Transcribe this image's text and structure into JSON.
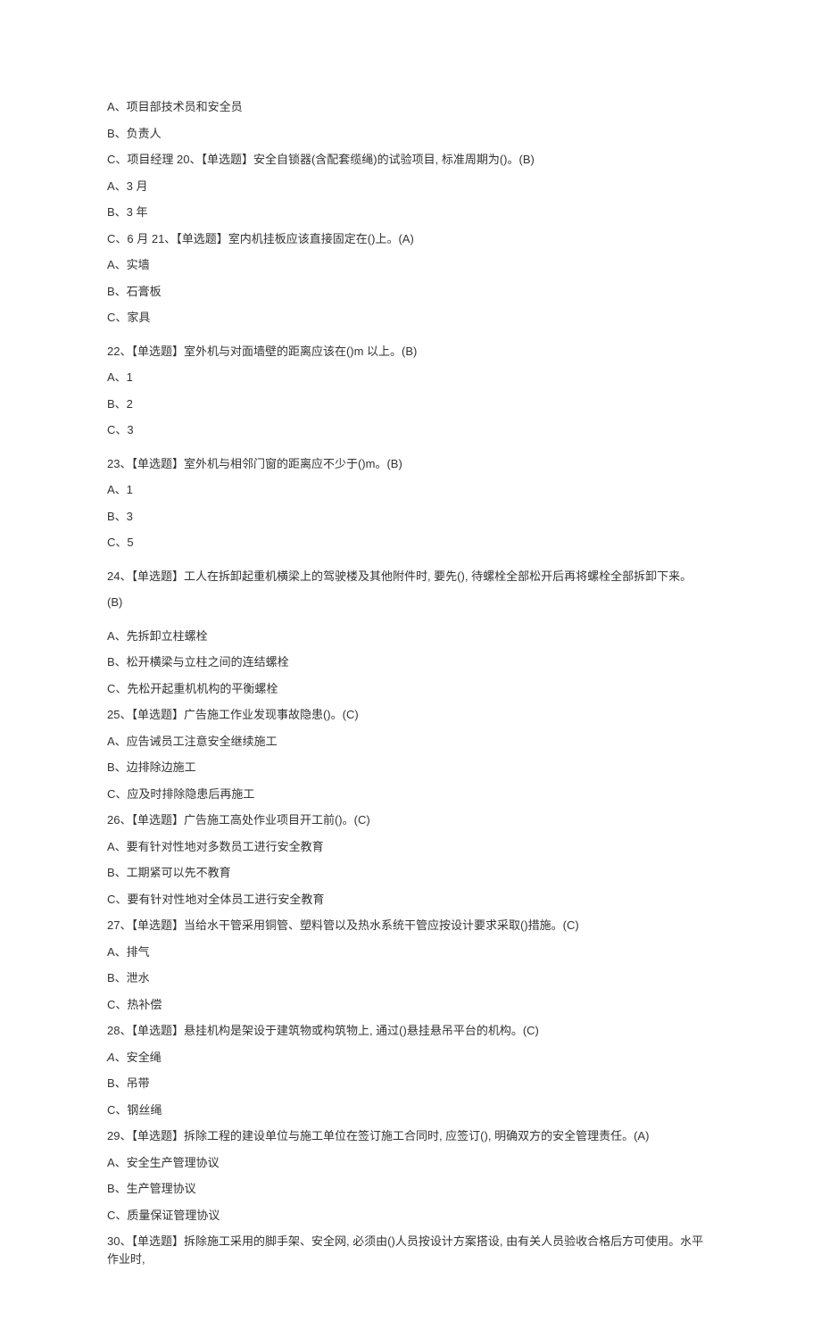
{
  "lines": [
    "A、项目部技术员和安全员",
    "B、负责人",
    "C、项目经理 20、【单选题】安全自锁器(含配套缆绳)的试验项目, 标准周期为()。(B)",
    "A、3 月",
    "B、3 年",
    "C、6 月 21、【单选题】室内机挂板应该直接固定在()上。(A)",
    "A、实墙",
    "B、石膏板",
    "C、家具"
  ],
  "q22": {
    "stem": "22、【单选题】室外机与对面墙壁的距离应该在()m 以上。(B)",
    "opts": [
      "A、1",
      "B、2",
      "C、3"
    ]
  },
  "q23": {
    "stem": "23、【单选题】室外机与相邻门窗的距离应不少于()m。(B)",
    "opts": [
      "A、1",
      "B、3",
      "C、5"
    ]
  },
  "q24": {
    "stem": "24、【单选题】工人在拆卸起重机横梁上的驾驶楼及其他附件时, 要先(), 待螺栓全部松开后再将螺栓全部拆卸下来。",
    "answer": "(B)",
    "opts": [
      "A、先拆卸立柱螺栓",
      "B、松开横梁与立柱之间的连结螺栓",
      "C、先松开起重机机构的平衡螺栓"
    ]
  },
  "q25": {
    "stem": "25、【单选题】广告施工作业发现事故隐患()。(C)",
    "opts": [
      "A、应告诫员工注意安全继续施工",
      "B、边排除边施工",
      "C、应及时排除隐患后再施工"
    ]
  },
  "q26": {
    "stem": "26、【单选题】广告施工高处作业项目开工前()。(C)",
    "opts": [
      "A、要有针对性地对多数员工进行安全教育",
      "B、工期紧可以先不教育",
      "C、要有针对性地对全体员工进行安全教育"
    ]
  },
  "q27": {
    "stem": "27、【单选题】当给水干管采用铜管、塑料管以及热水系统干管应按设计要求采取()措施。(C)",
    "opts": [
      "A、排气",
      "B、泄水",
      "C、热补偿"
    ]
  },
  "q28": {
    "stem": "28、【单选题】悬挂机构是架设于建筑物或构筑物上, 通过()悬挂悬吊平台的机构。(C)",
    "optA_prefix": "A",
    "optA_label": "、安全绳",
    "opts": [
      "B、吊带",
      "C、钢丝绳"
    ]
  },
  "q29": {
    "stem": "29、【单选题】拆除工程的建设单位与施工单位在签订施工合同时, 应签订(), 明确双方的安全管理责任。(A)",
    "opts": [
      "A、安全生产管理协议",
      "B、生产管理协议",
      "C、质量保证管理协议"
    ]
  },
  "q30": {
    "stem": "30、【单选题】拆除施工采用的脚手架、安全网, 必须由()人员按设计方案搭设, 由有关人员验收合格后方可使用。水平作业时,"
  }
}
